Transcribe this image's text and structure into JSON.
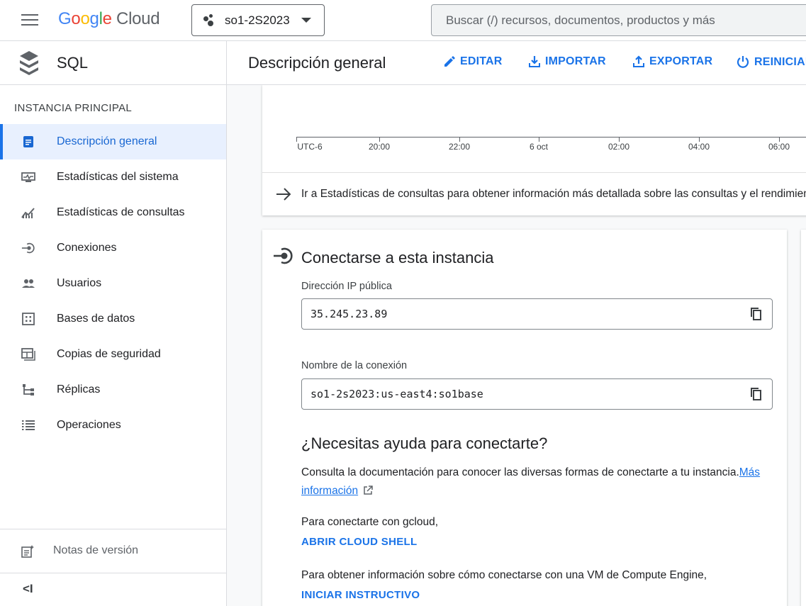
{
  "topbar": {
    "logo_google": [
      "G",
      "o",
      "o",
      "g",
      "l",
      "e"
    ],
    "logo_cloud": "Cloud",
    "project": "so1-2S2023",
    "search_placeholder": "Buscar (/) recursos, documentos, productos y más"
  },
  "sidebar": {
    "product": "SQL",
    "section": "INSTANCIA PRINCIPAL",
    "items": [
      {
        "label": "Descripción general",
        "icon": "overview-icon"
      },
      {
        "label": "Estadísticas del sistema",
        "icon": "monitor-icon"
      },
      {
        "label": "Estadísticas de consultas",
        "icon": "query-insights-icon"
      },
      {
        "label": "Conexiones",
        "icon": "connections-icon"
      },
      {
        "label": "Usuarios",
        "icon": "users-icon"
      },
      {
        "label": "Bases de datos",
        "icon": "databases-icon"
      },
      {
        "label": "Copias de seguridad",
        "icon": "backups-icon"
      },
      {
        "label": "Réplicas",
        "icon": "replicas-icon"
      },
      {
        "label": "Operaciones",
        "icon": "operations-icon"
      }
    ],
    "release_notes": "Notas de versión",
    "collapse": "<I"
  },
  "header": {
    "title": "Descripción general",
    "actions": {
      "edit": "EDITAR",
      "import": "IMPORTAR",
      "export": "EXPORTAR",
      "restart": "REINICIAR"
    }
  },
  "chart": {
    "ticks": [
      "UTC-6",
      "20:00",
      "22:00",
      "6 oct",
      "02:00",
      "04:00",
      "06:00"
    ]
  },
  "insights_link": "Ir a Estadísticas de consultas para obtener información más detallada sobre las consultas y el rendimiento",
  "connect": {
    "title": "Conectarse a esta instancia",
    "ip_label": "Dirección IP pública",
    "ip_value": "35.245.23.89",
    "conn_label": "Nombre de la conexión",
    "conn_value": "so1-2s2023:us-east4:so1base",
    "help_title": "¿Necesitas ayuda para conectarte?",
    "help_text": "Consulta la documentación para conocer las diversas formas de conectarte a tu instancia.",
    "help_link": "Más información",
    "gcloud_text": "Para conectarte con gcloud,",
    "gcloud_cta": "ABRIR CLOUD SHELL",
    "vm_text": "Para obtener información sobre cómo conectarse con una VM de Compute Engine,",
    "vm_cta": "INICIAR INSTRUCTIVO"
  },
  "colors": {
    "accent": "#1a73e8",
    "active_bg": "#e8f0fe"
  }
}
